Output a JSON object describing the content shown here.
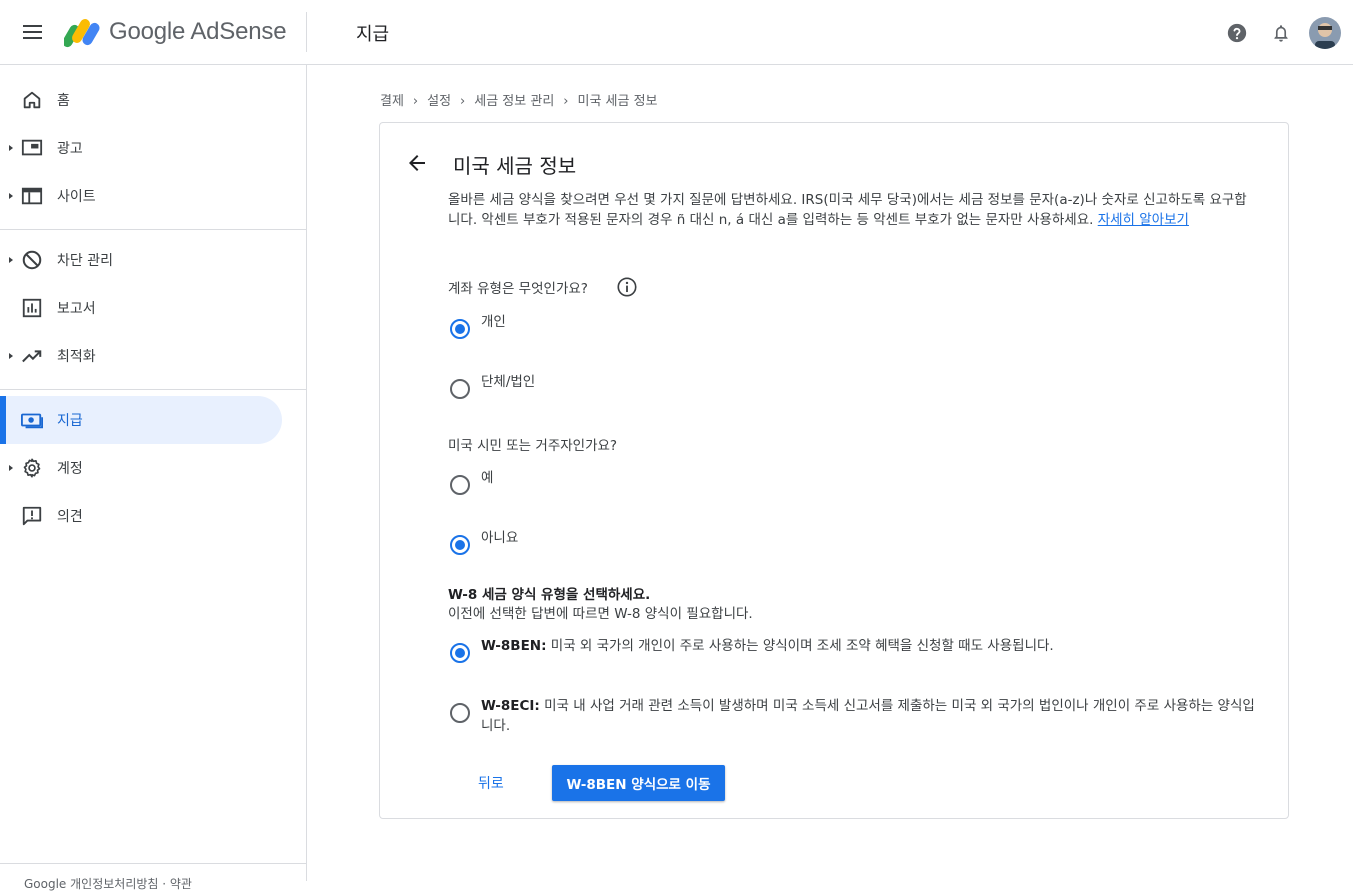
{
  "header": {
    "brand": "Google AdSense",
    "title": "지급"
  },
  "sidebar": {
    "items": [
      {
        "label": "홈",
        "icon": "home-icon",
        "caret": false
      },
      {
        "label": "광고",
        "icon": "ads-icon",
        "caret": true
      },
      {
        "label": "사이트",
        "icon": "sites-icon",
        "caret": true
      },
      {
        "label": "차단 관리",
        "icon": "block-icon",
        "caret": true
      },
      {
        "label": "보고서",
        "icon": "reports-icon",
        "caret": false
      },
      {
        "label": "최적화",
        "icon": "trending-icon",
        "caret": true
      },
      {
        "label": "지급",
        "icon": "payments-icon",
        "caret": false,
        "active": true
      },
      {
        "label": "계정",
        "icon": "gear-icon",
        "caret": true
      },
      {
        "label": "의견",
        "icon": "feedback-icon",
        "caret": false
      }
    ],
    "footer": "Google 개인정보처리방침 · 약관"
  },
  "breadcrumb": [
    "결제",
    "설정",
    "세금 정보 관리",
    "미국 세금 정보"
  ],
  "card": {
    "title": "미국 세금 정보",
    "intro": "올바른 세금 양식을 찾으려면 우선 몇 가지 질문에 답변하세요. IRS(미국 세무 당국)에서는 세금 정보를 문자(a-z)나 숫자로 신고하도록 요구합니다. 악센트 부호가 적용된 문자의 경우 ñ 대신 n, á 대신 a를 입력하는 등 악센트 부호가 없는 문자만 사용하세요. ",
    "learn_more": "자세히 알아보기",
    "q1": {
      "text": "계좌 유형은 무엇인가요?",
      "options": [
        "개인",
        "단체/법인"
      ],
      "selected": 0
    },
    "q2": {
      "text": "미국 시민 또는 거주자인가요?",
      "options": [
        "예",
        "아니요"
      ],
      "selected": 1
    },
    "q3": {
      "text": "W-8 세금 양식 유형을 선택하세요.",
      "subtext": "이전에 선택한 답변에 따르면 W-8 양식이 필요합니다.",
      "options": [
        {
          "code": "W-8BEN:",
          "desc": " 미국 외 국가의 개인이 주로 사용하는 양식이며 조세 조약 혜택을 신청할 때도 사용됩니다."
        },
        {
          "code": "W-8ECI:",
          "desc": " 미국 내 사업 거래 관련 소득이 발생하며 미국 소득세 신고서를 제출하는 미국 외 국가의 법인이나 개인이 주로 사용하는 양식입니다."
        }
      ],
      "selected": 0
    },
    "back_label": "뒤로",
    "primary_label": "W-8BEN 양식으로 이동"
  },
  "colors": {
    "accent": "#1a73e8",
    "active_bg": "#e8f0fe",
    "divider": "#dadce0"
  }
}
